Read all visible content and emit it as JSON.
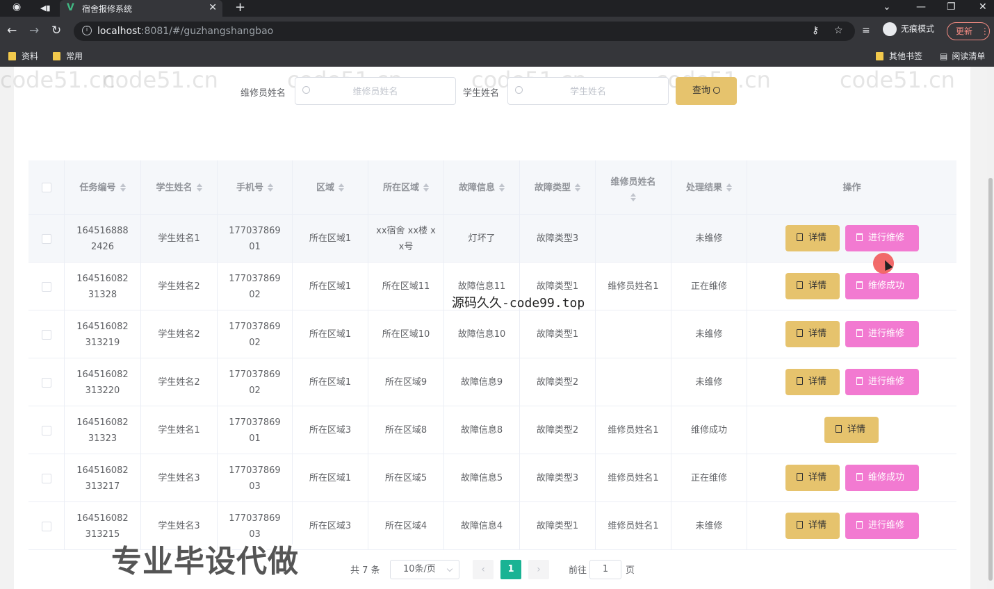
{
  "browser": {
    "tab_title": "宿舍报修系统",
    "url_host": "localhost",
    "url_rest": ":8081/#/guzhangshangbao",
    "incognito_label": "无痕模式",
    "update_label": "更新",
    "bookmarks": [
      "资料",
      "常用"
    ],
    "bookmarks_right": [
      "其他书签",
      "阅读清单"
    ]
  },
  "search": {
    "repair_label": "维修员姓名",
    "repair_placeholder": "维修员姓名",
    "student_label": "学生姓名",
    "student_placeholder": "学生姓名",
    "query_label": "查询"
  },
  "table": {
    "columns": [
      "任务编号",
      "学生姓名",
      "手机号",
      "区域",
      "所在区域",
      "故障信息",
      "故障类型",
      "维修员姓名",
      "处理结果",
      "操作"
    ],
    "rows": [
      {
        "task_no": "1645168882426",
        "student": "学生姓名1",
        "phone": "17703786901",
        "area": "所在区域1",
        "location": "xx宿舍 xx楼 xx号",
        "fault": "灯坏了",
        "fault_type": "故障类型3",
        "repairer": "",
        "result": "未维修",
        "detail": "详情",
        "action": "进行维修"
      },
      {
        "task_no": "16451608231328",
        "student": "学生姓名2",
        "phone": "17703786902",
        "area": "所在区域1",
        "location": "所在区域11",
        "fault": "故障信息11",
        "fault_type": "故障类型1",
        "repairer": "维修员姓名1",
        "result": "正在维修",
        "detail": "详情",
        "action": "维修成功"
      },
      {
        "task_no": "164516082313219",
        "student": "学生姓名2",
        "phone": "17703786902",
        "area": "所在区域1",
        "location": "所在区域10",
        "fault": "故障信息10",
        "fault_type": "故障类型1",
        "repairer": "",
        "result": "未维修",
        "detail": "详情",
        "action": "进行维修"
      },
      {
        "task_no": "164516082313220",
        "student": "学生姓名2",
        "phone": "17703786902",
        "area": "所在区域1",
        "location": "所在区域9",
        "fault": "故障信息9",
        "fault_type": "故障类型2",
        "repairer": "",
        "result": "未维修",
        "detail": "详情",
        "action": "进行维修"
      },
      {
        "task_no": "16451608231323",
        "student": "学生姓名1",
        "phone": "17703786901",
        "area": "所在区域3",
        "location": "所在区域8",
        "fault": "故障信息8",
        "fault_type": "故障类型2",
        "repairer": "维修员姓名1",
        "result": "维修成功",
        "detail": "详情",
        "action": ""
      },
      {
        "task_no": "164516082313217",
        "student": "学生姓名3",
        "phone": "17703786903",
        "area": "所在区域1",
        "location": "所在区域5",
        "fault": "故障信息5",
        "fault_type": "故障类型3",
        "repairer": "维修员姓名1",
        "result": "正在维修",
        "detail": "详情",
        "action": "维修成功"
      },
      {
        "task_no": "164516082313215",
        "student": "学生姓名3",
        "phone": "17703786903",
        "area": "所在区域3",
        "location": "所在区域4",
        "fault": "故障信息4",
        "fault_type": "故障类型1",
        "repairer": "维修员姓名1",
        "result": "未维修",
        "detail": "详情",
        "action": "进行维修"
      }
    ]
  },
  "pagination": {
    "total": "共 7 条",
    "page_size": "10条/页",
    "current": "1",
    "goto_label": "前往",
    "goto_value": "1",
    "page_suffix": "页"
  },
  "overlays": {
    "watermark": "code51.cn",
    "center_text": "源码久久-code99.top",
    "banner": "专业毕设代做"
  },
  "colors": {
    "detail_button": "#e6c36d",
    "action_button": "#f27ad1",
    "page_active": "#1ab394"
  }
}
